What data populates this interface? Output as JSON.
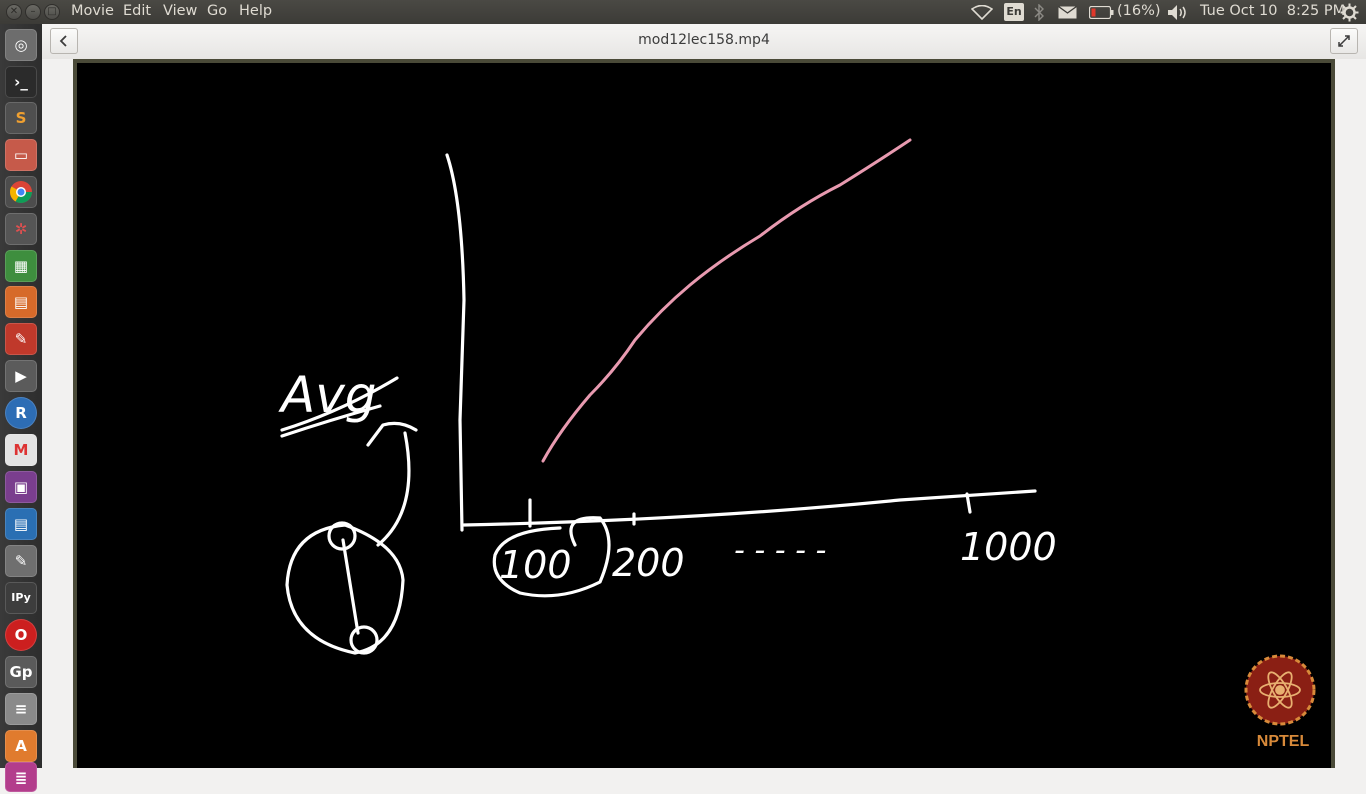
{
  "panel": {
    "menu": [
      "Movie",
      "Edit",
      "View",
      "Go",
      "Help"
    ],
    "lang": "En",
    "battery": "(16%)",
    "datetime": "Tue Oct 10  8:25 PM"
  },
  "launcher": {
    "icons": [
      "dash-icon",
      "terminal-icon",
      "sublime-text-icon",
      "files-icon",
      "chrome-icon",
      "settings-icon",
      "calc-icon",
      "impress-icon",
      "document-viewer-icon",
      "video-icon",
      "r-icon",
      "gmail-icon",
      "media-icon",
      "writer-icon",
      "text-editor-icon",
      "ipython-icon",
      "opera-icon",
      "gnuplot-icon",
      "drive-icon",
      "software-icon",
      "stack-icon"
    ]
  },
  "window": {
    "title": "mod12lec158.mp4"
  },
  "video": {
    "handwriting": {
      "axis_label": "Avg",
      "x_ticks": [
        "100",
        "200",
        "- - - - -",
        "1000"
      ]
    },
    "logo_text": "NPTEL",
    "colors": {
      "curve": "#e89ab0",
      "chalk": "#ffffff",
      "logo": "#d88a3a"
    }
  }
}
